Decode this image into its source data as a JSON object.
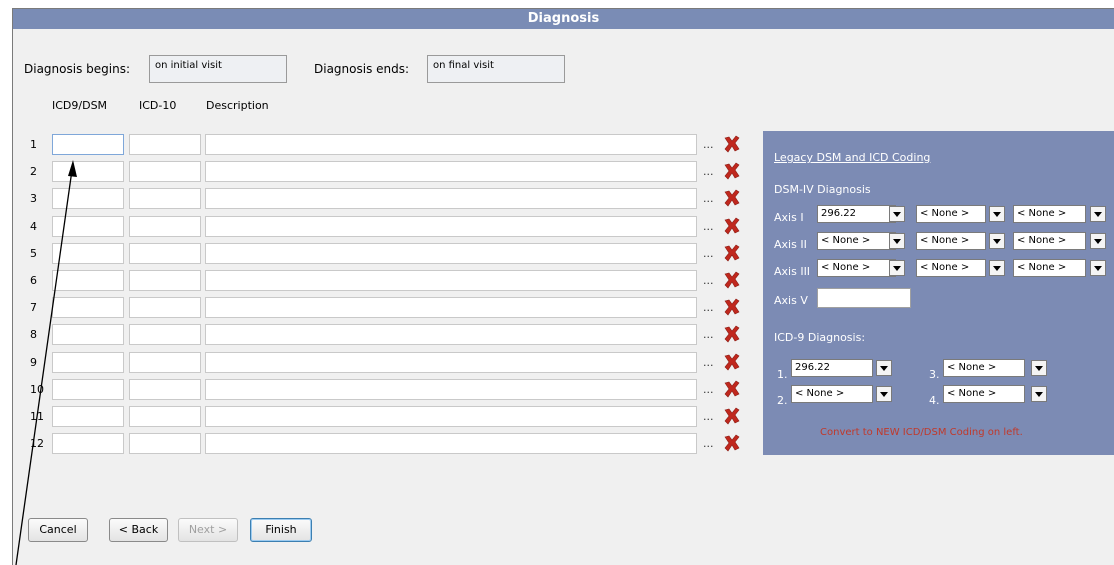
{
  "title": "Diagnosis",
  "diagnosis_begins": {
    "label": "Diagnosis begins:",
    "value": "on initial visit"
  },
  "diagnosis_ends": {
    "label": "Diagnosis ends:",
    "value": "on final visit"
  },
  "columns": {
    "icd9": "ICD9/DSM",
    "icd10": "ICD-10",
    "description": "Description"
  },
  "rows": [
    "1",
    "2",
    "3",
    "4",
    "5",
    "6",
    "7",
    "8",
    "9",
    "10",
    "11",
    "12"
  ],
  "row_browse": "...",
  "legacy": {
    "heading": "Legacy DSM and ICD Coding",
    "dsm_heading": "DSM-IV Diagnosis",
    "axis_labels": {
      "axis1": "Axis I",
      "axis2": "Axis II",
      "axis3": "Axis III",
      "axis5": "Axis V"
    },
    "axis1": [
      "296.22",
      "< None >",
      "< None >"
    ],
    "axis2": [
      "< None >",
      "< None >",
      "< None >"
    ],
    "axis3": [
      "< None >",
      "< None >",
      "< None >"
    ],
    "axis5_value": "",
    "icd9_heading": "ICD-9 Diagnosis:",
    "icd9_nums": [
      "1.",
      "2.",
      "3.",
      "4."
    ],
    "icd9": [
      "296.22",
      "< None >",
      "< None >",
      "< None >"
    ],
    "convert_note": "Convert to NEW ICD/DSM Coding on left."
  },
  "buttons": {
    "cancel": "Cancel",
    "back": "< Back",
    "next": "Next >",
    "finish": "Finish"
  },
  "colors": {
    "title_bg": "#7a8cb5",
    "panel_bg": "#7c8bb4",
    "delete_x": "#c0281e",
    "convert_note": "#c0392b"
  }
}
